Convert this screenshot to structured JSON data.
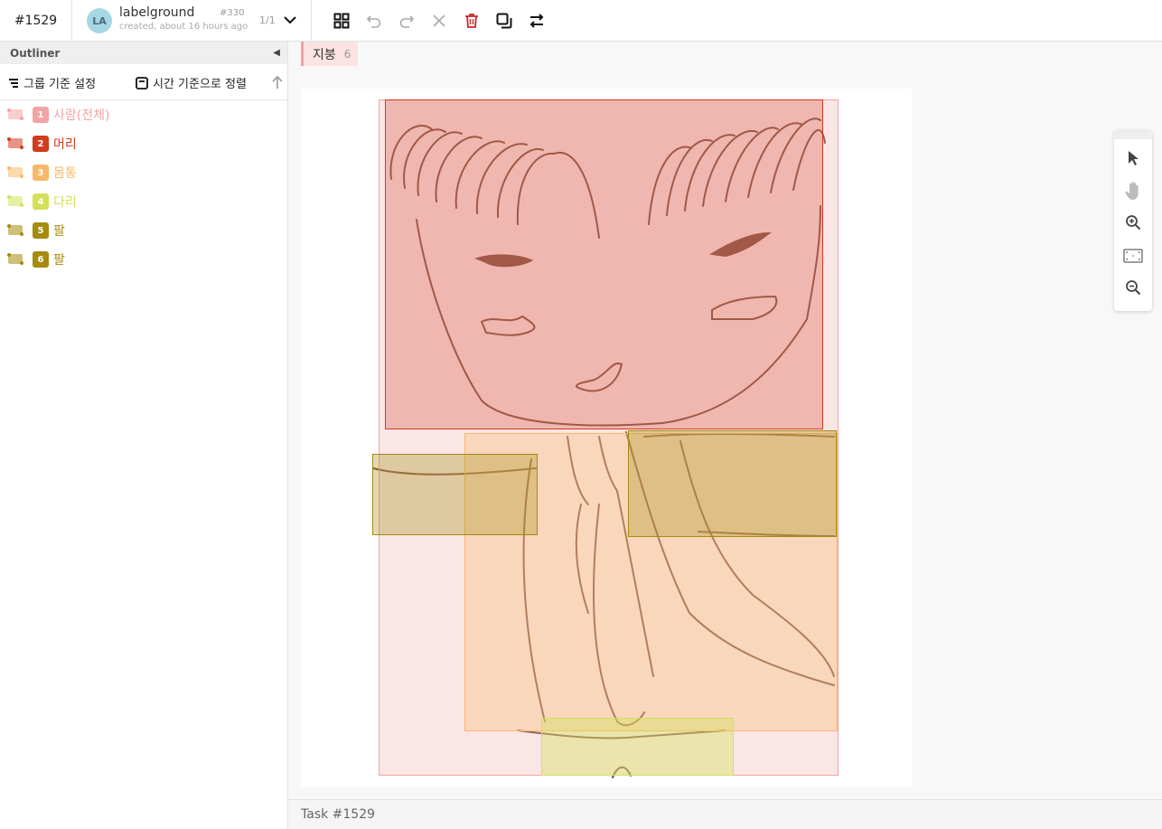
{
  "header": {
    "task_id": "#1529",
    "project": {
      "avatar": "LA",
      "name": "labelground",
      "subtitle": "created, about 16 hours ago",
      "number": "#330",
      "pagination": "1/1"
    },
    "toolbar_icons": [
      "grid-icon",
      "undo-icon",
      "redo-icon",
      "close-icon",
      "delete-icon",
      "copy-icon",
      "swap-icon"
    ]
  },
  "outliner": {
    "title": "Outliner",
    "group_label": "그룹 기준 설정",
    "sort_label": "시간 기준으로 정렬",
    "items": [
      {
        "num": "1",
        "label": "사람(전체)",
        "color": "#f2a4a4"
      },
      {
        "num": "2",
        "label": "머리",
        "color": "#d13c1f"
      },
      {
        "num": "3",
        "label": "몸통",
        "color": "#f7b968"
      },
      {
        "num": "4",
        "label": "다리",
        "color": "#d4e157"
      },
      {
        "num": "5",
        "label": "팔",
        "color": "#a68b0e"
      },
      {
        "num": "6",
        "label": "팔",
        "color": "#a68b0e"
      }
    ]
  },
  "canvas": {
    "tag": {
      "label": "지붕",
      "count": "6"
    }
  },
  "zoom_tools": [
    "pointer-icon",
    "hand-icon",
    "zoom-in-icon",
    "fit-icon",
    "zoom-out-icon"
  ],
  "status": {
    "text": "Task #1529"
  }
}
